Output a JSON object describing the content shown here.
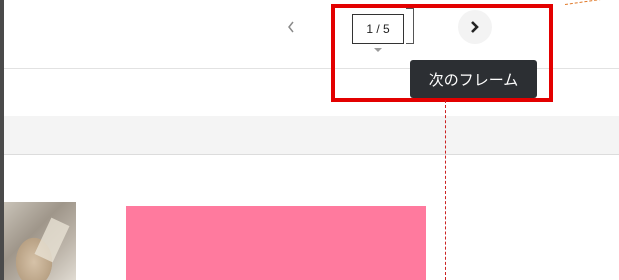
{
  "navigation": {
    "prev_icon": "chevron-left-icon",
    "next_icon": "chevron-right-icon",
    "frame_counter": "1 / 5"
  },
  "tooltip": {
    "text": "次のフレーム"
  },
  "annotation": {
    "highlight_color": "#e30000",
    "guide_line_color": "#cc2222"
  },
  "canvas": {
    "block_color": "#ff7a9e"
  }
}
